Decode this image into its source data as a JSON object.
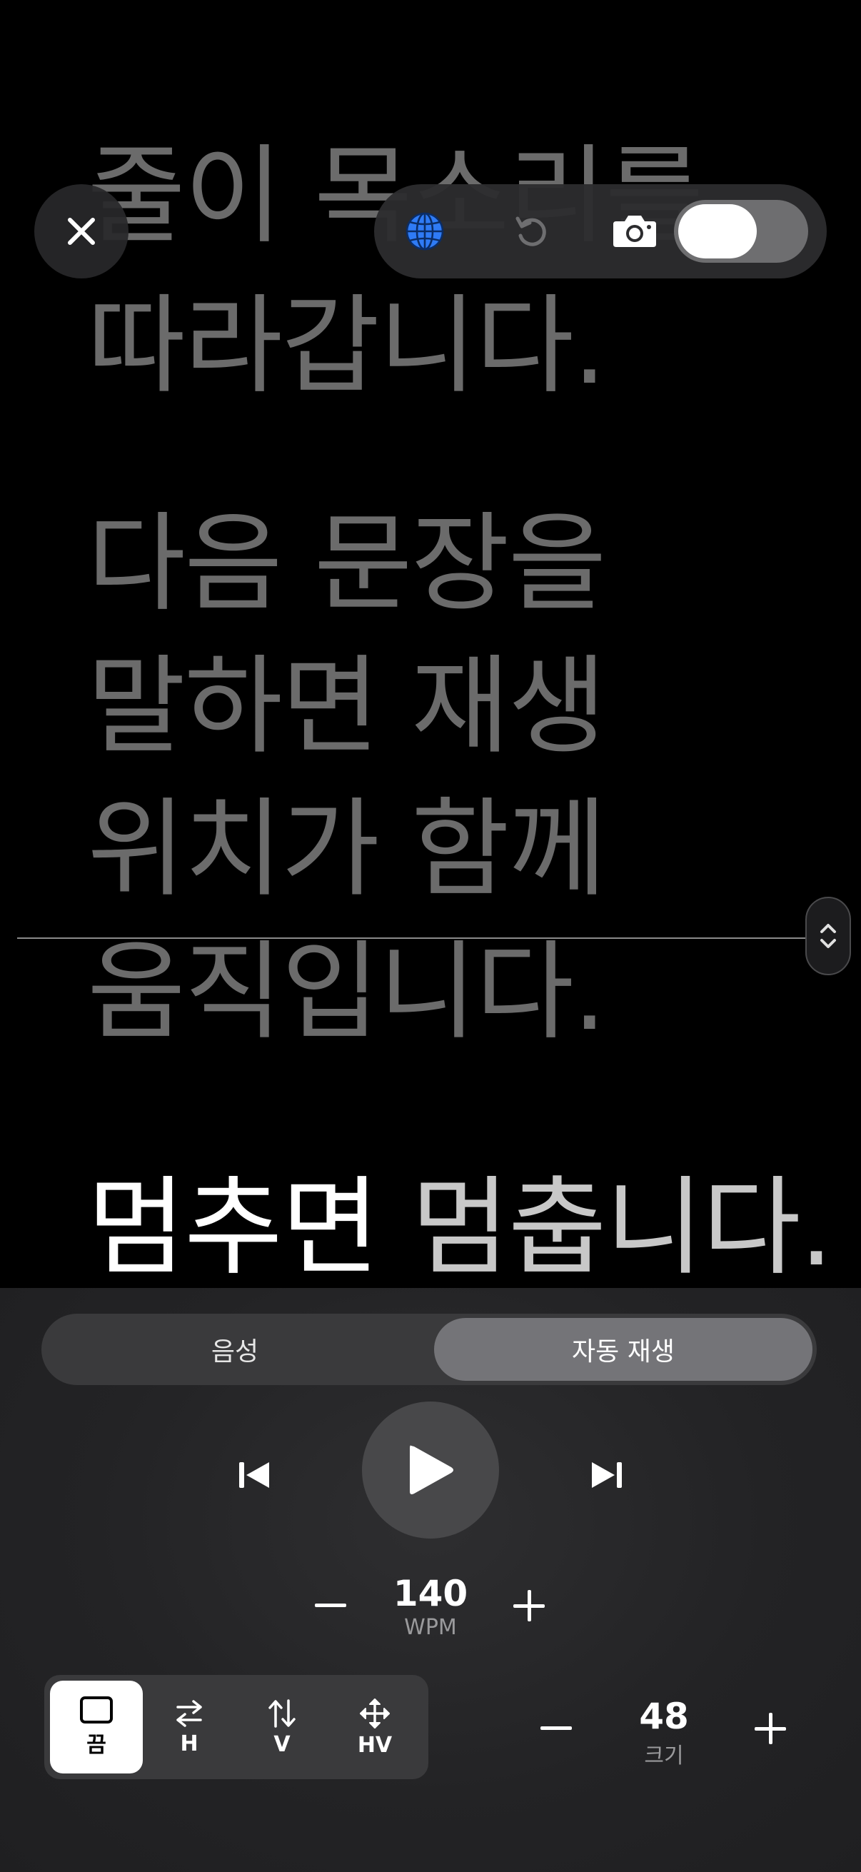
{
  "prompter": {
    "line1": "줄이 목소리를",
    "line2": "따라갑니다.",
    "line3": "다음 문장을",
    "line4": "말하면 재생",
    "line5": "위치가 함께",
    "line6": "움직입니다.",
    "line7_spoken": "멈추면",
    "line7_next": "멈춥니다."
  },
  "toolbar": {
    "close_icon": "close-icon",
    "language_icon": "globe-icon",
    "undo_icon": "undo-icon",
    "camera_icon": "camera-icon",
    "mirror_toggle_on": true
  },
  "mode": {
    "tabs": [
      "음성",
      "자동 재생"
    ],
    "selected": "자동 재생"
  },
  "playback": {
    "skip_back_icon": "skip-back-icon",
    "play_icon": "play-icon",
    "skip_forward_icon": "skip-forward-icon"
  },
  "speed": {
    "value": "140",
    "unit": "WPM"
  },
  "scroll_modes": {
    "options": [
      {
        "label": "끔",
        "icon": "square-icon"
      },
      {
        "label": "H",
        "icon": "horizontal-arrows-icon"
      },
      {
        "label": "V",
        "icon": "vertical-arrows-icon"
      },
      {
        "label": "HV",
        "icon": "move-arrows-icon"
      }
    ],
    "selected": "끔"
  },
  "font_size": {
    "value": "48",
    "label": "크기"
  },
  "colors": {
    "spoken_text": "#ffffff",
    "upcoming_text": "#6b6b6b",
    "globe_accent": "#2f7bf5",
    "panel_bg": "#232325"
  }
}
